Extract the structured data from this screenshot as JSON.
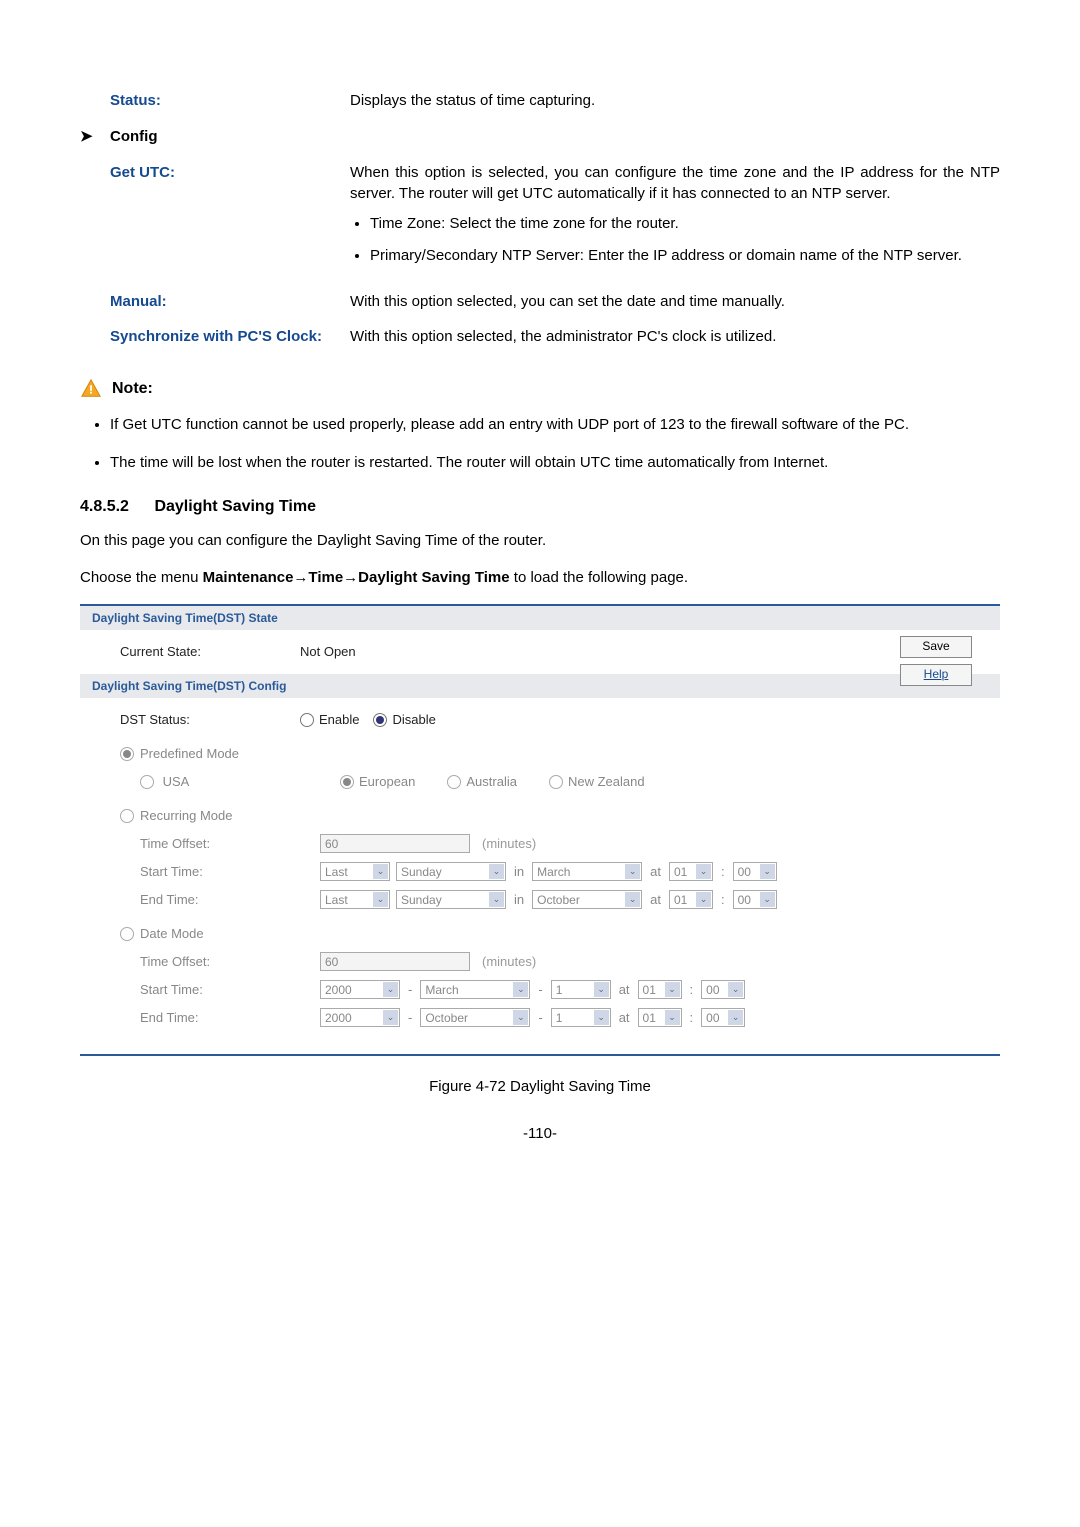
{
  "status": {
    "label": "Status:",
    "desc": "Displays the status of time capturing."
  },
  "config": {
    "heading": "Config",
    "get_utc": {
      "label": "Get UTC:",
      "desc": "When this option is selected, you can configure the time zone and the IP address for the NTP server. The router will get UTC automatically if it has connected to an NTP server.",
      "bullet1": "Time Zone: Select the time zone for the router.",
      "bullet2": "Primary/Secondary NTP Server: Enter the IP address or domain name of the NTP server."
    },
    "manual": {
      "label": "Manual:",
      "desc": "With this option selected, you can set the date and time manually."
    },
    "sync": {
      "label": "Synchronize with PC'S Clock:",
      "desc": "With this option selected, the administrator PC's clock is utilized."
    }
  },
  "note": {
    "title": "Note:",
    "item1": "If Get UTC function cannot be used properly, please add an entry with UDP port of 123 to the firewall software of the PC.",
    "item2": "The time will be lost when the router is restarted. The router will obtain UTC time automatically from Internet."
  },
  "dst_section": {
    "number": "4.8.5.2",
    "title": "Daylight Saving Time",
    "intro": "On this page you can configure the Daylight Saving Time of the router.",
    "menu_prefix": "Choose the menu ",
    "menu_path": "Maintenance→Time→Daylight Saving Time",
    "menu_suffix": " to load the following page."
  },
  "panel": {
    "state_head": "Daylight Saving Time(DST) State",
    "current_state_label": "Current State:",
    "current_state_value": "Not Open",
    "config_head": "Daylight Saving Time(DST) Config",
    "dst_status_label": "DST Status:",
    "enable": "Enable",
    "disable": "Disable",
    "predefined_mode": "Predefined Mode",
    "usa": "USA",
    "european": "European",
    "australia": "Australia",
    "new_zealand": "New Zealand",
    "recurring_mode": "Recurring Mode",
    "time_offset": "Time Offset:",
    "time_offset_val": "60",
    "minutes": "(minutes)",
    "start_time": "Start Time:",
    "end_time": "End Time:",
    "recur_start": {
      "week": "Last",
      "day": "Sunday",
      "in": "in",
      "month": "March",
      "at": "at",
      "h": "01",
      "m": "00"
    },
    "recur_end": {
      "week": "Last",
      "day": "Sunday",
      "in": "in",
      "month": "October",
      "at": "at",
      "h": "01",
      "m": "00"
    },
    "date_mode": "Date Mode",
    "date_start": {
      "year": "2000",
      "dash": "-",
      "month": "March",
      "d": "1",
      "at": "at",
      "h": "01",
      "m": "00"
    },
    "date_end": {
      "year": "2000",
      "dash": "-",
      "month": "October",
      "d": "1",
      "at": "at",
      "h": "01",
      "m": "00"
    },
    "save": "Save",
    "help": "Help",
    "colon": ":"
  },
  "figure_caption": "Figure 4-72 Daylight Saving Time",
  "page_number": "-110-"
}
